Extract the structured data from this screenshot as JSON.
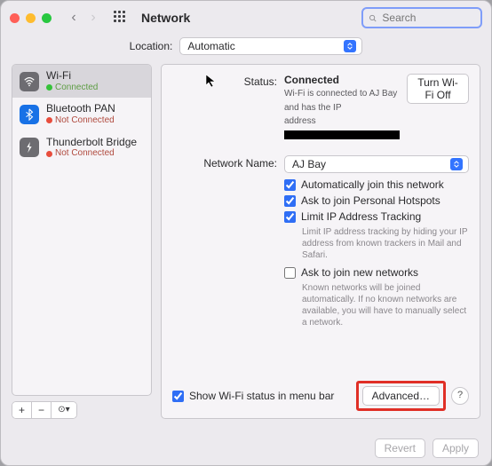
{
  "window": {
    "title": "Network"
  },
  "search": {
    "placeholder": "Search"
  },
  "location": {
    "label": "Location:",
    "value": "Automatic"
  },
  "sidebar": {
    "items": [
      {
        "name": "Wi-Fi",
        "status": "Connected",
        "dot": "g",
        "icon": "wifi",
        "selected": true
      },
      {
        "name": "Bluetooth PAN",
        "status": "Not Connected",
        "dot": "r",
        "icon": "bt",
        "selected": false
      },
      {
        "name": "Thunderbolt Bridge",
        "status": "Not Connected",
        "dot": "r",
        "icon": "tb",
        "selected": false
      }
    ],
    "buttons": {
      "add": "+",
      "remove": "−",
      "more": "⊙▾"
    }
  },
  "status": {
    "label": "Status:",
    "value": "Connected",
    "toggle": "Turn Wi-Fi Off",
    "desc_a": "Wi-Fi is connected to AJ Bay and has the IP",
    "desc_b": "address"
  },
  "network": {
    "label": "Network Name:",
    "value": "AJ Bay",
    "auto_join": "Automatically join this network",
    "ask_hotspot": "Ask to join Personal Hotspots",
    "limit_ip": "Limit IP Address Tracking",
    "limit_ip_help": "Limit IP address tracking by hiding your IP address from known trackers in Mail and Safari.",
    "ask_new": "Ask to join new networks",
    "ask_new_help": "Known networks will be joined automatically. If no known networks are available, you will have to manually select a network."
  },
  "menubar": {
    "label": "Show Wi-Fi status in menu bar"
  },
  "buttons": {
    "advanced": "Advanced…",
    "help": "?",
    "revert": "Revert",
    "apply": "Apply"
  }
}
